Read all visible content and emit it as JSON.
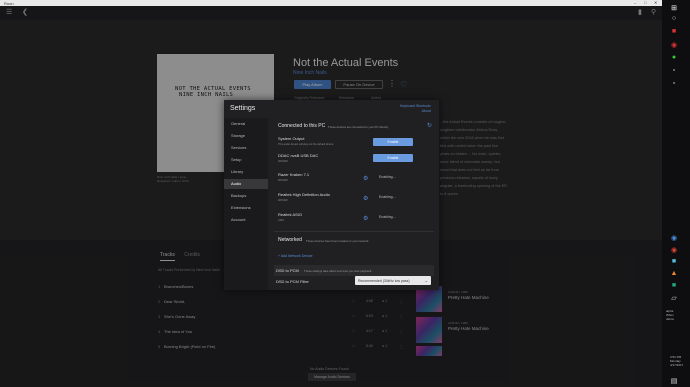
{
  "window": {
    "title": "Roon"
  },
  "album": {
    "title": "Not the Actual Events",
    "artist": "Nine Inch Nails",
    "cover_text_1": "NOT THE ACTUAL EVENTS",
    "cover_text_2": "NINE INCH NAILS",
    "play_label": "Play Album",
    "pause_label": "Pause On Device",
    "meta": [
      "Originally Released",
      "Released",
      "Added"
    ],
    "description": "...the Actual Events consists of rougher, longtime collaborator Atticus Ross, which the new 2016 when he was first tied with control when the past five years on hidden ... his main, quieter, more blend of cinematic sweep, but mood that does not feel as far from previous releases, squalls of fuzzy angular, a foreboding opening of the EP, to 8 opens",
    "caption_1": "Nine Inch Nails / Jane",
    "caption_2": "Released / Label / 2016"
  },
  "tabs": {
    "tracks": "Tracks",
    "credits": "Credits",
    "note": "All Tracks Performed by Nine Inch Nails"
  },
  "tracks": [
    {
      "num": "1",
      "name": "Branches/Bones",
      "dur": "",
      "plays": ""
    },
    {
      "num": "2",
      "name": "Dear World,",
      "dur": "4:06",
      "plays": "● 1"
    },
    {
      "num": "3",
      "name": "She's Gone Away",
      "dur": "6:03",
      "plays": "● 1"
    },
    {
      "num": "4",
      "name": "The Idea of You",
      "dur": "4:17",
      "plays": "● 1"
    },
    {
      "num": "5",
      "name": "Burning Bright (Field on Fire)",
      "dur": "5:40",
      "plays": "● 1"
    }
  ],
  "releases": [
    {
      "label": "ALBUM • 1989",
      "name": "Pretty Hate Machine"
    },
    {
      "label": "ALBUM • 1989",
      "name": "Pretty Hate Machine"
    }
  ],
  "footer": {
    "message": "No Audio Devices Found",
    "button": "Manage Audio Devices"
  },
  "settings": {
    "title": "Settings",
    "keyboard_shortcuts": "Keyboard Shortcuts",
    "about": "About",
    "nav": [
      "General",
      "Storage",
      "Services",
      "Setup",
      "Library",
      "Audio",
      "Backups",
      "Extensions",
      "Account"
    ],
    "active": "Audio",
    "connected_title": "Connected to this PC",
    "connected_sub": "These devices are connected to your PC directly.",
    "devices": [
      {
        "name": "System Output",
        "sub": "This audio device will play out the default device.",
        "state": "Enable"
      },
      {
        "name": "DDAC nvsB USB DAC",
        "sub": "WASAPI",
        "state": "Enable"
      },
      {
        "name": "Razer Kraken 7.1",
        "sub": "WASAPI",
        "state": "Enabling..."
      },
      {
        "name": "Realtek High Definition Audio",
        "sub": "WASAPI",
        "state": "Enabling..."
      },
      {
        "name": "Realtek ASIO",
        "sub": "ASIO",
        "state": "Enabling..."
      }
    ],
    "networked_title": "Networked",
    "networked_sub": "These devices have been located on your network.",
    "add_device": "+ Add Network Device",
    "dsd_title": "DSD to PCM",
    "dsd_sub": "These settings take effect next time you start playback.",
    "dsd_filter_label": "DSD to PCM Filter",
    "dsd_filter_value": "Recommended (30kHz low pass)"
  },
  "tray": {
    "time": "3:51 PM",
    "day": "Monday",
    "date": "4/17/2017",
    "lang1": "alpha",
    "lang2": "Wbox",
    "lang3": "dsbox"
  }
}
